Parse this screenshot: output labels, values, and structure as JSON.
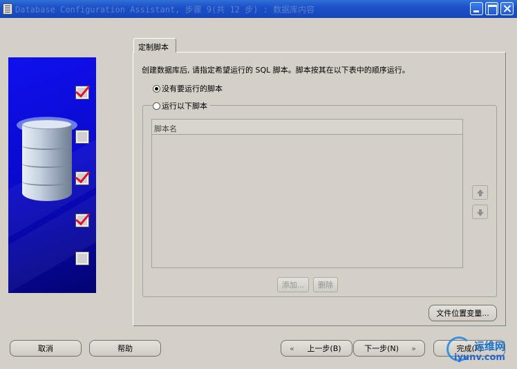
{
  "window": {
    "title": "Database Configuration Assistant, 步骤 9(共 12 步) : 数据库内容"
  },
  "tab": {
    "label": "定制脚本"
  },
  "description": "创建数据库后, 请指定希望运行的 SQL 脚本。脚本按其在以下表中的顺序运行。",
  "radios": {
    "no_scripts": "没有要运行的脚本",
    "run_scripts": "运行以下脚本"
  },
  "table": {
    "header": "脚本名"
  },
  "buttons": {
    "add": "添加...",
    "delete": "删除",
    "file_location_vars": "文件位置变量...",
    "cancel": "取消",
    "help": "帮助",
    "back": "上一步(B)",
    "next": "下一步(N)",
    "finish": "完成(F)"
  },
  "watermark": {
    "name": "运维网",
    "url": "iyunv.com"
  },
  "icons": [
    "app-icon",
    "minimize-icon",
    "maximize-icon",
    "close-icon",
    "database-icon",
    "checkbox-icon",
    "arrow-up-icon",
    "arrow-down-icon"
  ]
}
